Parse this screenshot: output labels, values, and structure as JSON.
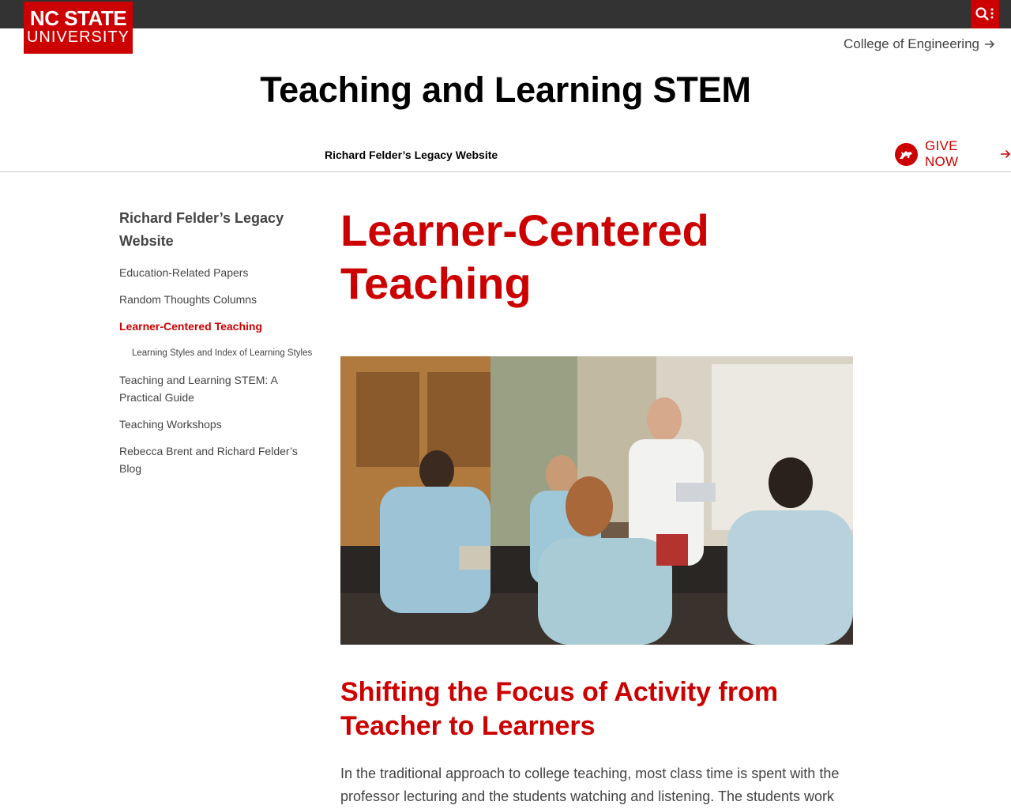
{
  "brand": {
    "line1": "NC STATE",
    "line2": "UNIVERSITY",
    "color": "#cc0000"
  },
  "utility": {
    "search_icon": "search-icon",
    "more_icon": "vertical-dots-icon"
  },
  "college_link": {
    "label": "College of Engineering",
    "icon": "arrow-right-icon"
  },
  "site_title": "Teaching and Learning STEM",
  "main_nav": {
    "item": "Richard Felder’s Legacy Website"
  },
  "give": {
    "label": "GIVE NOW",
    "icon": "wolf-icon",
    "arrow": "arrow-right-icon"
  },
  "sidebar": {
    "title": "Richard Felder’s Legacy Website",
    "items": [
      {
        "label": "Education-Related Papers"
      },
      {
        "label": "Random Thoughts Columns"
      },
      {
        "label": "Learner-Centered Teaching",
        "active": true
      },
      {
        "label": "Learning Styles and Index of Learning Styles",
        "sub": true
      },
      {
        "label": "Teaching and Learning STEM: A Practical Guide"
      },
      {
        "label": "Teaching Workshops"
      },
      {
        "label": "Rebecca Brent and Richard Felder’s Blog"
      }
    ]
  },
  "main": {
    "title": "Learner-Centered Teaching",
    "hero_image": "photo of a lab classroom with an instructor in a lab coat and students in protective gear",
    "section_heading": "Shifting the Focus of Activity from Teacher to Learners",
    "paragraph": "In the traditional approach to college teaching, most class time is spent with the professor lecturing and the students watching and listening. The students work"
  },
  "colors": {
    "accent": "#cc0000",
    "topbar": "#333333",
    "text": "#444444"
  }
}
